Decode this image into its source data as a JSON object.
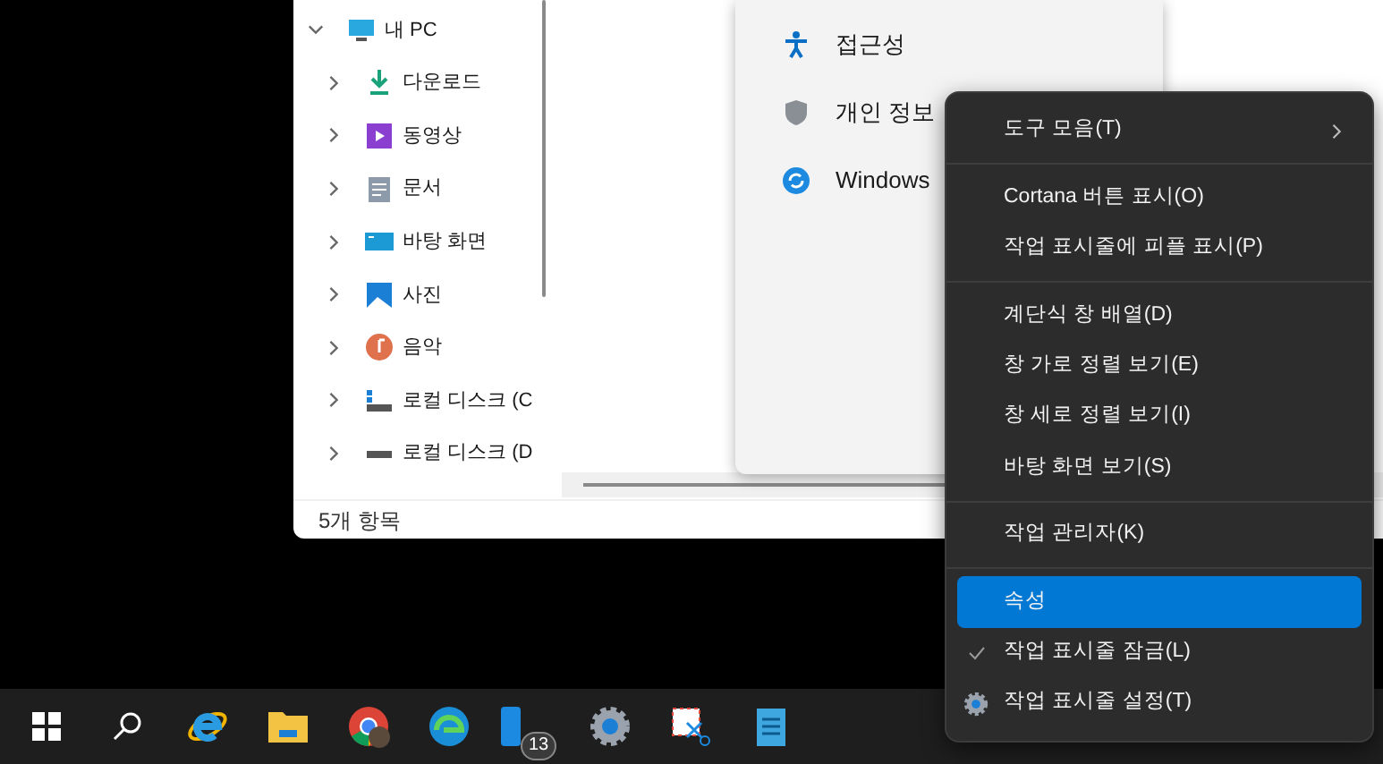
{
  "explorer": {
    "nav_tree": [
      {
        "label": "내 PC",
        "expanded": true,
        "children": [
          {
            "label": "다운로드",
            "expanded": false
          },
          {
            "label": "동영상",
            "expanded": false
          },
          {
            "label": "문서",
            "expanded": false
          },
          {
            "label": "바탕 화면",
            "expanded": false
          },
          {
            "label": "사진",
            "expanded": false
          },
          {
            "label": "음악",
            "expanded": false
          },
          {
            "label": "로컬 디스크 (C",
            "expanded": false
          },
          {
            "label": "로컬 디스크 (D",
            "expanded": false
          }
        ]
      }
    ],
    "status_bar": "5개 항목"
  },
  "flyout": {
    "items": [
      "접근성",
      "개인 정보",
      "Windows"
    ]
  },
  "context_menu": {
    "groups": [
      [
        {
          "label": "도구 모음(T)",
          "kind": "submenu",
          "selected": false,
          "checked": false
        }
      ],
      [
        {
          "label": "Cortana 버튼 표시(O)",
          "kind": "plain",
          "selected": false,
          "checked": false
        },
        {
          "label": "작업 표시줄에 피플 표시(P)",
          "kind": "plain",
          "selected": false,
          "checked": false
        }
      ],
      [
        {
          "label": "계단식 창 배열(D)",
          "kind": "plain",
          "selected": false,
          "checked": false
        },
        {
          "label": "창 가로 정렬 보기(E)",
          "kind": "plain",
          "selected": false,
          "checked": false
        },
        {
          "label": "창 세로 정렬 보기(I)",
          "kind": "plain",
          "selected": false,
          "checked": false
        },
        {
          "label": "바탕 화면 보기(S)",
          "kind": "plain",
          "selected": false,
          "checked": false
        }
      ],
      [
        {
          "label": "작업 관리자(K)",
          "kind": "plain",
          "selected": false,
          "checked": false
        }
      ],
      [
        {
          "label": "속성",
          "kind": "plain",
          "selected": true,
          "checked": false
        },
        {
          "label": "작업 표시줄 잠금(L)",
          "kind": "plain",
          "selected": false,
          "checked": true
        },
        {
          "label": "작업 표시줄 설정(T)",
          "kind": "settings",
          "selected": false,
          "checked": false
        }
      ]
    ]
  },
  "taskbar": {
    "badge": "13"
  }
}
